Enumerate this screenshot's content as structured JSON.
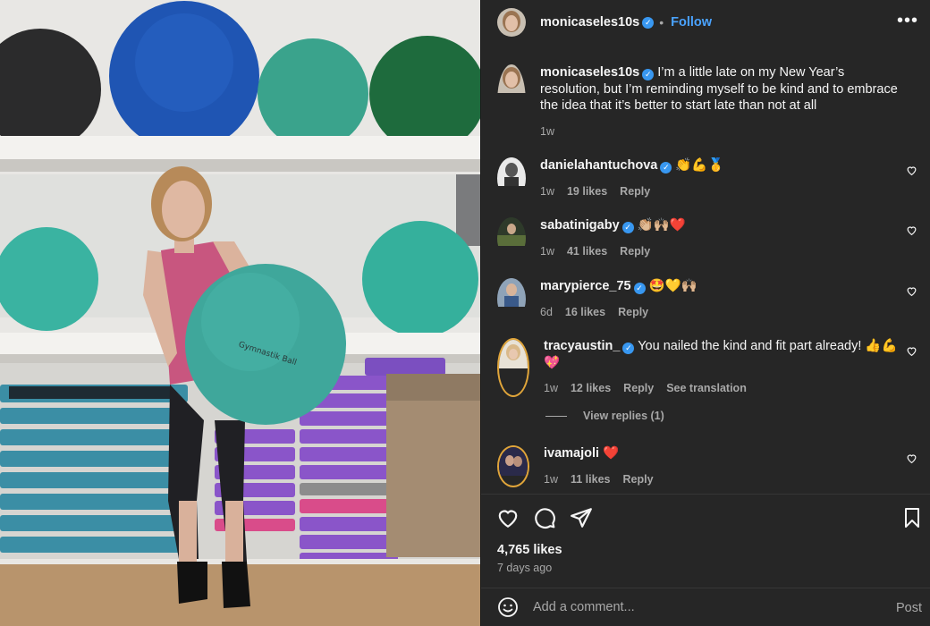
{
  "header": {
    "username": "monicaseles10s",
    "separator": "•",
    "follow_label": "Follow",
    "more_label": "•••"
  },
  "caption": {
    "username": "monicaseles10s",
    "text": "I’m a little late on my New Year’s resolution, but I’m reminding myself to be kind and to embrace the idea that it’s better to start late than not at all",
    "time": "1w"
  },
  "comments": [
    {
      "username": "danielahantuchova",
      "text": "👏💪🥇",
      "time": "1w",
      "likes": "19 likes",
      "reply": "Reply"
    },
    {
      "username": "sabatinigaby",
      "text": "👏🏼🙌🏼❤️",
      "time": "1w",
      "likes": "41 likes",
      "reply": "Reply"
    },
    {
      "username": "marypierce_75",
      "text": "🤩💛🙌🏼",
      "time": "6d",
      "likes": "16 likes",
      "reply": "Reply"
    },
    {
      "username": "tracyaustin_",
      "text": "You nailed the kind and fit part already! 👍💪💖",
      "time": "1w",
      "likes": "12 likes",
      "reply": "Reply",
      "translate": "See translation"
    },
    {
      "username": "ivamajoli",
      "text": "❤️",
      "time": "1w",
      "likes": "11 likes",
      "reply": "Reply"
    }
  ],
  "view_replies": "View replies (1)",
  "footer": {
    "likes": "4,765 likes",
    "ago": "7 days ago",
    "comment_placeholder": "Add a comment...",
    "post_label": "Post"
  },
  "icons": {
    "like": "heart-icon",
    "comment": "comment-icon",
    "share": "share-icon",
    "save": "bookmark-icon",
    "emoji": "emoji-icon",
    "verified": "verified-badge-icon"
  },
  "colors": {
    "panel_bg": "#262626",
    "link_blue": "#4aa3ff",
    "verified_blue": "#3897f0",
    "muted": "#a8a8a8",
    "heart_red": "#ff3040"
  }
}
